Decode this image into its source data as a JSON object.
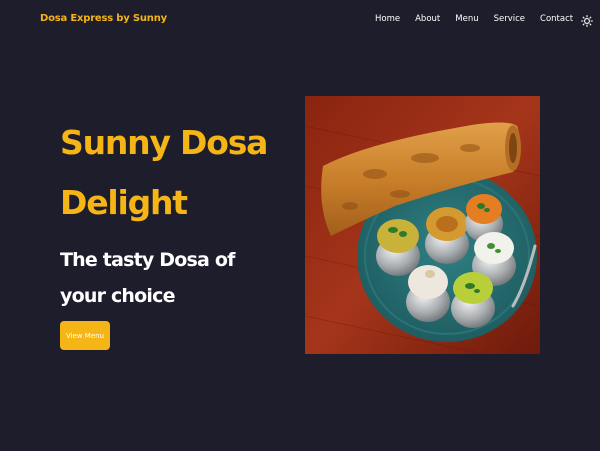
{
  "nav": {
    "brand": "Dosa Express by Sunny",
    "items": [
      {
        "label": "Home"
      },
      {
        "label": "About"
      },
      {
        "label": "Menu"
      },
      {
        "label": "Service"
      },
      {
        "label": "Contact"
      }
    ],
    "theme_icon": "sun-icon"
  },
  "hero": {
    "title_line1": "Sunny Dosa",
    "title_line2": "Delight",
    "subtitle_line1": "The tasty Dosa of",
    "subtitle_line2": "your choice",
    "cta_label": "View Menu",
    "image_icon": "dosa-plate-image"
  },
  "colors": {
    "background": "#1e1d2b",
    "accent": "#f5b516",
    "text": "#ffffff"
  }
}
